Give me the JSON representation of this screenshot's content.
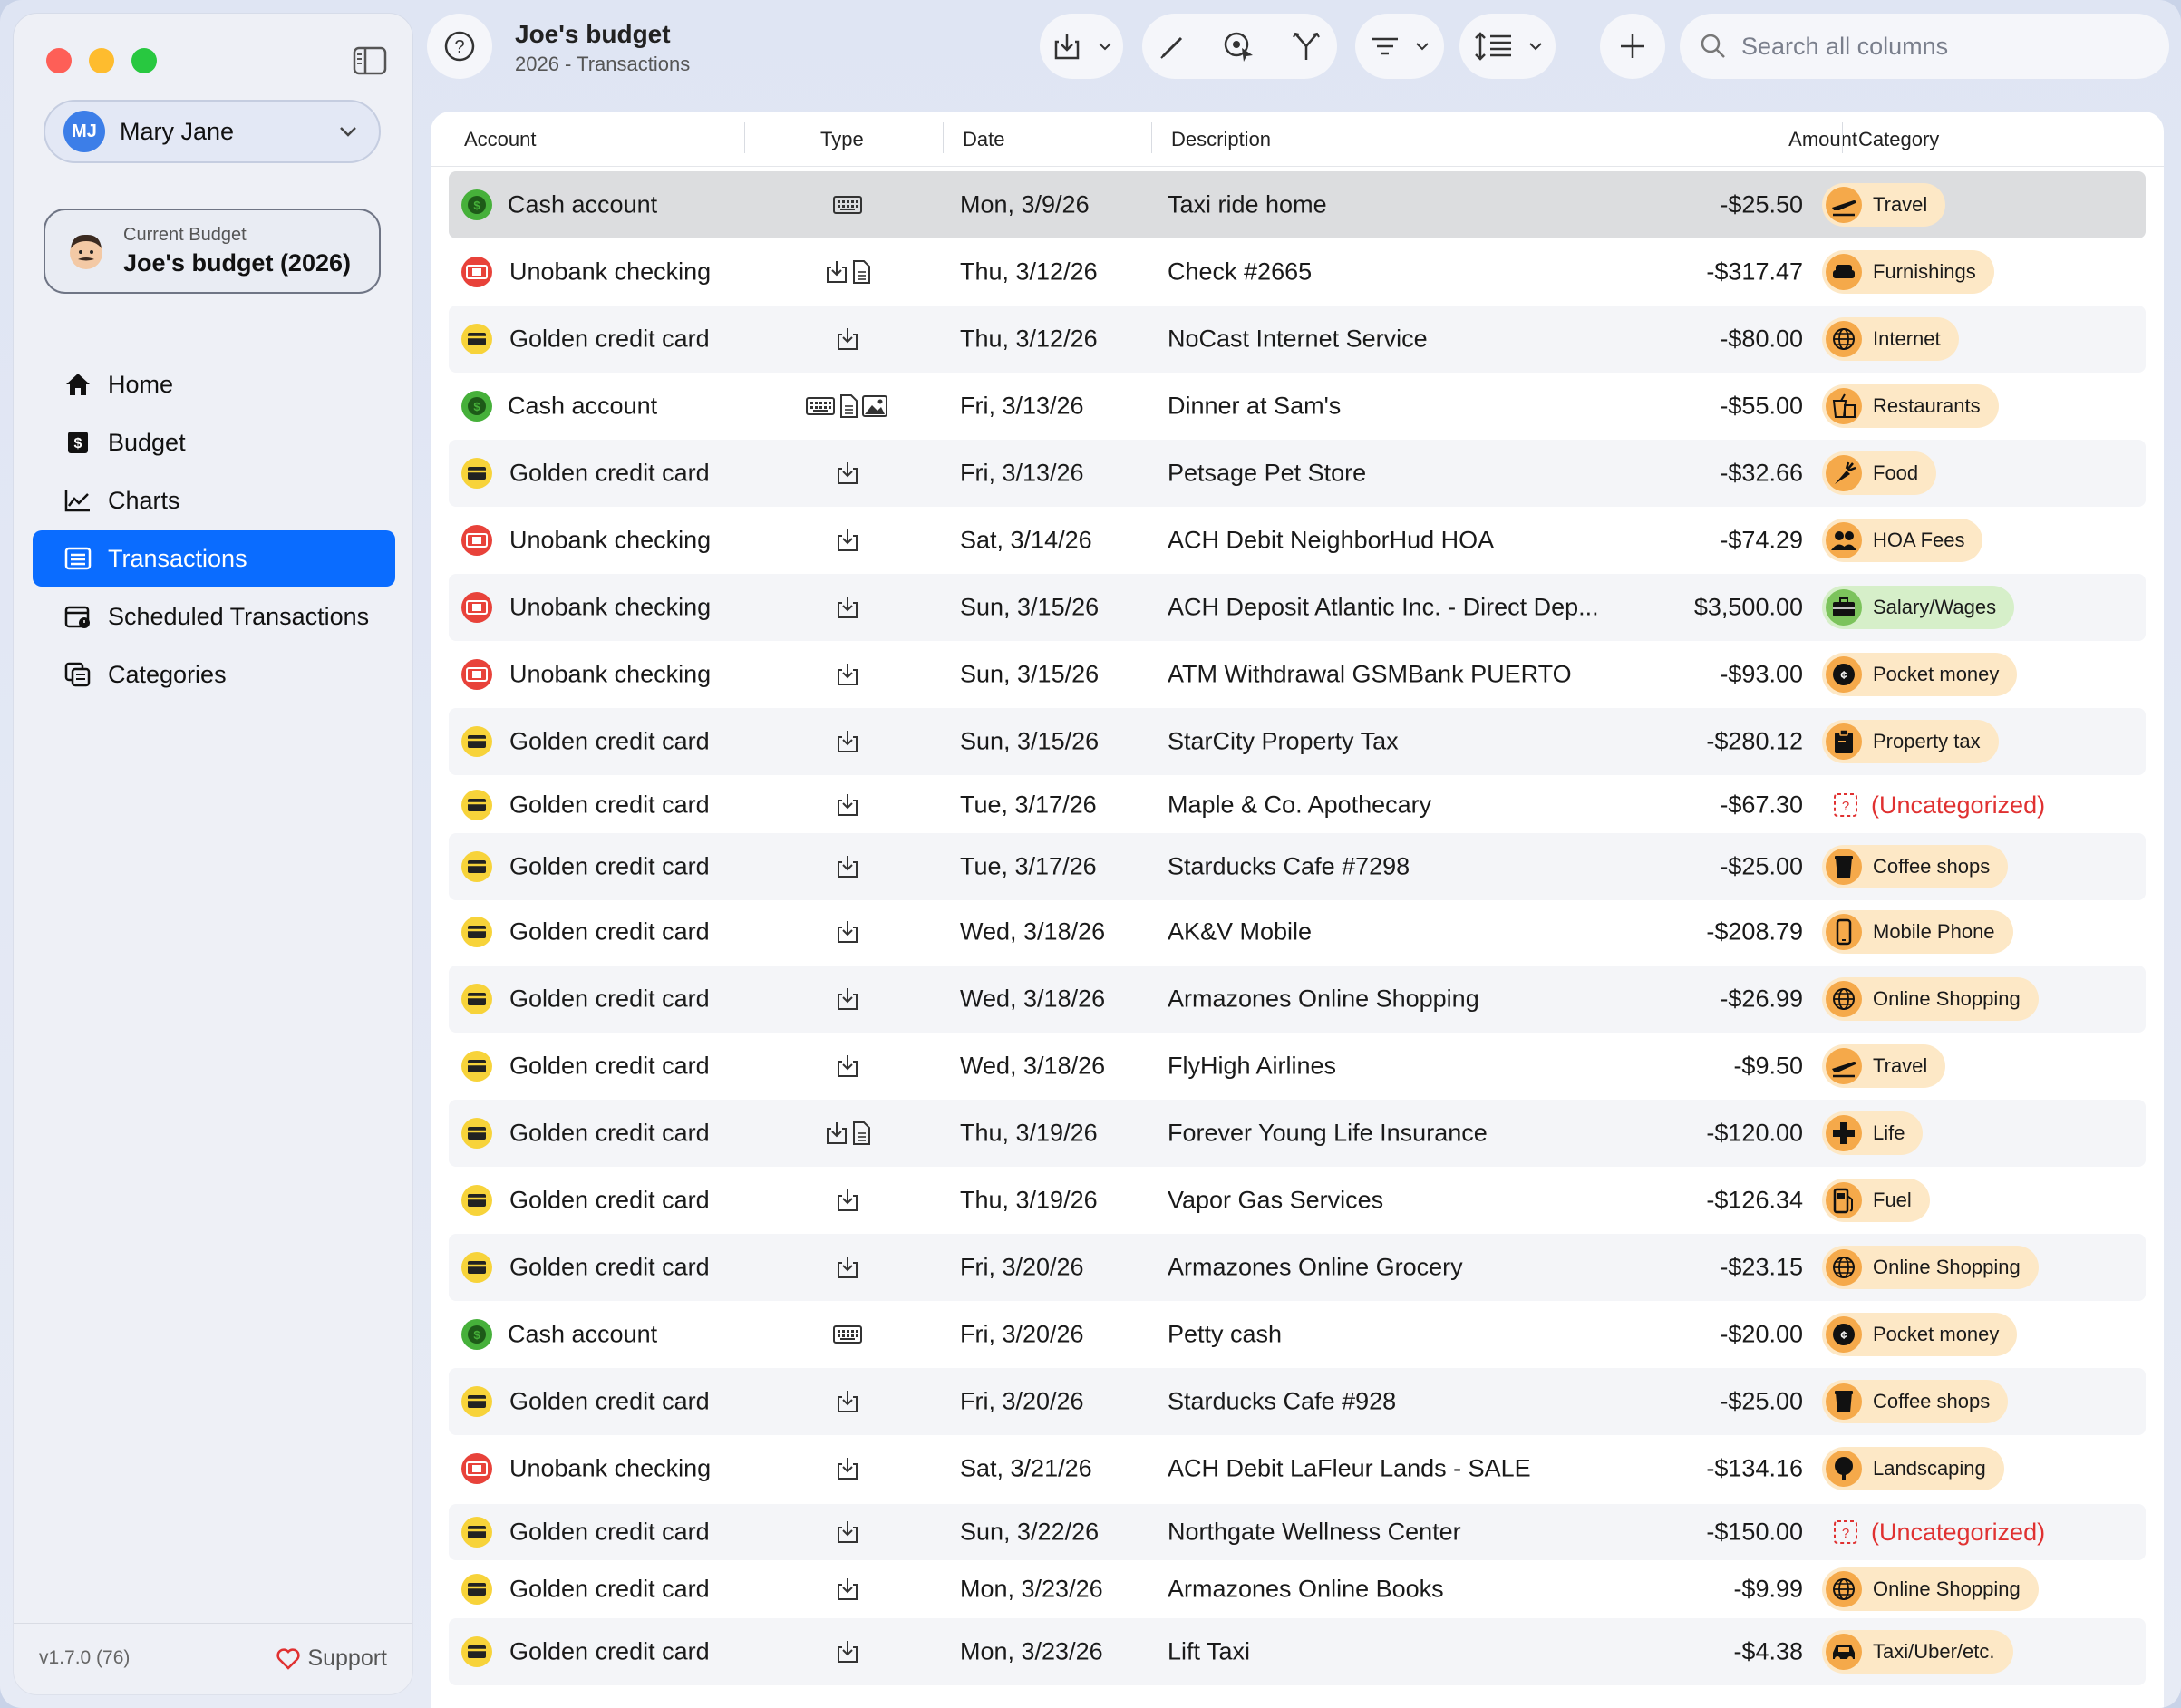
{
  "sidebar": {
    "user": {
      "initials": "MJ",
      "name": "Mary Jane"
    },
    "budget_caption": "Current Budget",
    "budget_name": "Joe's budget (2026)",
    "nav": [
      {
        "label": "Home",
        "icon": "house-icon"
      },
      {
        "label": "Budget",
        "icon": "dollar-book-icon"
      },
      {
        "label": "Charts",
        "icon": "line-chart-icon"
      },
      {
        "label": "Transactions",
        "icon": "list-icon",
        "active": true
      },
      {
        "label": "Scheduled Transactions",
        "icon": "calendar-clock-icon"
      },
      {
        "label": "Categories",
        "icon": "categories-icon"
      }
    ],
    "version": "v1.7.0 (76)",
    "support_label": "Support"
  },
  "toolbar": {
    "title": "Joe's budget",
    "subtitle": "2026 - Transactions",
    "search_placeholder": "Search all columns"
  },
  "table": {
    "columns": {
      "account": "Account",
      "type": "Type",
      "date": "Date",
      "description": "Description",
      "amount": "Amount",
      "category": "Category"
    },
    "rows": [
      {
        "account": "Cash account",
        "acct": "cash",
        "types": [
          "keyboard"
        ],
        "date": "Mon, 3/9/26",
        "description": "Taxi ride home",
        "amount": "-$25.50",
        "category": "Travel",
        "cat_icon": "plane"
      },
      {
        "account": "Unobank checking",
        "acct": "bank",
        "types": [
          "import",
          "doc"
        ],
        "date": "Thu, 3/12/26",
        "description": "Check #2665",
        "amount": "-$317.47",
        "category": "Furnishings",
        "cat_icon": "sofa"
      },
      {
        "account": "Golden credit card",
        "acct": "card",
        "types": [
          "import"
        ],
        "date": "Thu, 3/12/26",
        "description": "NoCast Internet Service",
        "amount": "-$80.00",
        "category": "Internet",
        "cat_icon": "globe"
      },
      {
        "account": "Cash account",
        "acct": "cash",
        "types": [
          "keyboard",
          "doc",
          "image"
        ],
        "date": "Fri, 3/13/26",
        "description": "Dinner at Sam's",
        "amount": "-$55.00",
        "category": "Restaurants",
        "cat_icon": "takeout"
      },
      {
        "account": "Golden credit card",
        "acct": "card",
        "types": [
          "import"
        ],
        "date": "Fri, 3/13/26",
        "description": "Petsage Pet Store",
        "amount": "-$32.66",
        "category": "Food",
        "cat_icon": "carrot"
      },
      {
        "account": "Unobank checking",
        "acct": "bank",
        "types": [
          "import"
        ],
        "date": "Sat, 3/14/26",
        "description": "ACH Debit NeighborHud HOA",
        "amount": "-$74.29",
        "category": "HOA Fees",
        "cat_icon": "people"
      },
      {
        "account": "Unobank checking",
        "acct": "bank",
        "types": [
          "import"
        ],
        "date": "Sun, 3/15/26",
        "description": "ACH Deposit Atlantic Inc. - Direct Dep...",
        "amount": "$3,500.00",
        "category": "Salary/Wages",
        "cat_icon": "briefcase",
        "income": true
      },
      {
        "account": "Unobank checking",
        "acct": "bank",
        "types": [
          "import"
        ],
        "date": "Sun, 3/15/26",
        "description": "ATM Withdrawal GSMBank PUERTO",
        "amount": "-$93.00",
        "category": "Pocket money",
        "cat_icon": "coin"
      },
      {
        "account": "Golden credit card",
        "acct": "card",
        "types": [
          "import"
        ],
        "date": "Sun, 3/15/26",
        "description": "StarCity Property Tax",
        "amount": "-$280.12",
        "category": "Property tax",
        "cat_icon": "clipboard"
      },
      {
        "account": "Golden credit card",
        "acct": "card",
        "types": [
          "import"
        ],
        "date": "Tue, 3/17/26",
        "description": "Maple & Co. Apothecary",
        "amount": "-$67.30",
        "category": "(Uncategorized)",
        "uncategorized": true
      },
      {
        "account": "Golden credit card",
        "acct": "card",
        "types": [
          "import"
        ],
        "date": "Tue, 3/17/26",
        "description": "Starducks Cafe #7298",
        "amount": "-$25.00",
        "category": "Coffee shops",
        "cat_icon": "cup"
      },
      {
        "account": "Golden credit card",
        "acct": "card",
        "types": [
          "import"
        ],
        "date": "Wed, 3/18/26",
        "description": "AK&V Mobile",
        "amount": "-$208.79",
        "category": "Mobile Phone",
        "cat_icon": "phone"
      },
      {
        "account": "Golden credit card",
        "acct": "card",
        "types": [
          "import"
        ],
        "date": "Wed, 3/18/26",
        "description": "Armazones Online Shopping",
        "amount": "-$26.99",
        "category": "Online Shopping",
        "cat_icon": "globe"
      },
      {
        "account": "Golden credit card",
        "acct": "card",
        "types": [
          "import"
        ],
        "date": "Wed, 3/18/26",
        "description": "FlyHigh Airlines",
        "amount": "-$9.50",
        "category": "Travel",
        "cat_icon": "plane"
      },
      {
        "account": "Golden credit card",
        "acct": "card",
        "types": [
          "import",
          "doc"
        ],
        "date": "Thu, 3/19/26",
        "description": "Forever Young Life Insurance",
        "amount": "-$120.00",
        "category": "Life",
        "cat_icon": "cross"
      },
      {
        "account": "Golden credit card",
        "acct": "card",
        "types": [
          "import"
        ],
        "date": "Thu, 3/19/26",
        "description": "Vapor Gas Services",
        "amount": "-$126.34",
        "category": "Fuel",
        "cat_icon": "fuel"
      },
      {
        "account": "Golden credit card",
        "acct": "card",
        "types": [
          "import"
        ],
        "date": "Fri, 3/20/26",
        "description": "Armazones Online Grocery",
        "amount": "-$23.15",
        "category": "Online Shopping",
        "cat_icon": "globe"
      },
      {
        "account": "Cash account",
        "acct": "cash",
        "types": [
          "keyboard"
        ],
        "date": "Fri, 3/20/26",
        "description": "Petty cash",
        "amount": "-$20.00",
        "category": "Pocket money",
        "cat_icon": "coin"
      },
      {
        "account": "Golden credit card",
        "acct": "card",
        "types": [
          "import"
        ],
        "date": "Fri, 3/20/26",
        "description": "Starducks Cafe #928",
        "amount": "-$25.00",
        "category": "Coffee shops",
        "cat_icon": "cup"
      },
      {
        "account": "Unobank checking",
        "acct": "bank",
        "types": [
          "import"
        ],
        "date": "Sat, 3/21/26",
        "description": "ACH Debit LaFleur Lands - SALE",
        "amount": "-$134.16",
        "category": "Landscaping",
        "cat_icon": "tree"
      },
      {
        "account": "Golden credit card",
        "acct": "card",
        "types": [
          "import"
        ],
        "date": "Sun, 3/22/26",
        "description": "Northgate Wellness Center",
        "amount": "-$150.00",
        "category": "(Uncategorized)",
        "uncategorized": true
      },
      {
        "account": "Golden credit card",
        "acct": "card",
        "types": [
          "import"
        ],
        "date": "Mon, 3/23/26",
        "description": "Armazones Online Books",
        "amount": "-$9.99",
        "category": "Online Shopping",
        "cat_icon": "globe"
      },
      {
        "account": "Golden credit card",
        "acct": "card",
        "types": [
          "import"
        ],
        "date": "Mon, 3/23/26",
        "description": "Lift Taxi",
        "amount": "-$4.38",
        "category": "Taxi/Uber/etc.",
        "cat_icon": "car"
      }
    ]
  },
  "colors": {
    "accent": "#0a6cff",
    "chip": "#fde8c6",
    "chip_income": "#d6efc9",
    "uncategorized": "#e03131",
    "cash": "#46b03a",
    "bank": "#e8423a",
    "card": "#f7d33a"
  }
}
